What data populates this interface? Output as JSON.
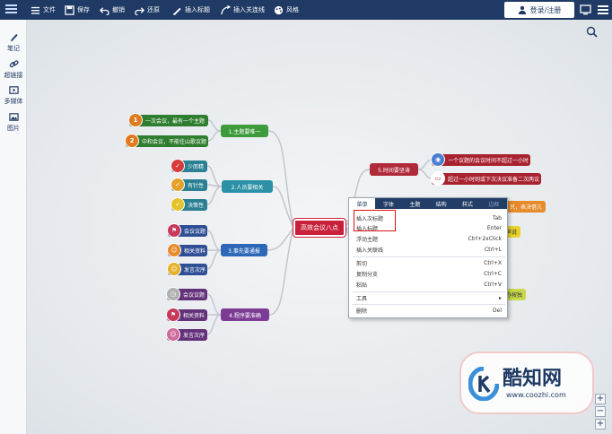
{
  "toolbar": {
    "file": "文件",
    "save": "保存",
    "undo": "撤销",
    "redo": "还原",
    "insert_title": "插入标题",
    "insert_relation": "插入关连线",
    "style": "风格",
    "login": "登录/注册"
  },
  "sidebar": {
    "items": [
      {
        "label": "笔记",
        "icon": "pen-icon"
      },
      {
        "label": "超链接",
        "icon": "link-icon"
      },
      {
        "label": "多媒体",
        "icon": "media-icon"
      },
      {
        "label": "图片",
        "icon": "image-icon"
      }
    ]
  },
  "mindmap": {
    "central": "高效会议八点",
    "branches": [
      {
        "label": "1.主题要唯一",
        "color": "#3d9b3c",
        "leaves": [
          {
            "label": "一次会议，最有一个主题",
            "num": "1"
          },
          {
            "label": "中和会议，不能往山歌议题",
            "num": "2"
          }
        ]
      },
      {
        "label": "2.人员要相关",
        "color": "#2c90a6",
        "leaves": [
          {
            "label": "少而精"
          },
          {
            "label": "有针性"
          },
          {
            "label": "决策性"
          }
        ]
      },
      {
        "label": "3.事先要通报",
        "color": "#2d67b8",
        "leaves": [
          {
            "label": "会议议题"
          },
          {
            "label": "相关资料"
          },
          {
            "label": "发言次序"
          }
        ]
      },
      {
        "label": "4.程序要准确",
        "color": "#7c3b94",
        "leaves": [
          {
            "label": "会议议题"
          },
          {
            "label": "相关资料"
          },
          {
            "label": "发言次序"
          }
        ]
      },
      {
        "label": "5.时间要坚涛",
        "color": "#b02a3a",
        "leaves": [
          {
            "label": "一个议题的会议时间不超过一小时"
          },
          {
            "label": "超过一小时则或下次决议准备二次两议"
          }
        ]
      }
    ],
    "partial_labels": [
      "只，表决借亢",
      "声说",
      "办按独"
    ]
  },
  "context_menu": {
    "tabs": [
      "菜单",
      "字体",
      "主题",
      "结构",
      "样式",
      "边框"
    ],
    "items": [
      {
        "label": "插入次标题",
        "shortcut": "Tab"
      },
      {
        "label": "插入标题",
        "shortcut": "Enter"
      },
      {
        "label": "浮动主题",
        "shortcut": "Ctrl+2xClick"
      },
      {
        "label": "插入关联线",
        "shortcut": "Ctrl+L"
      },
      {
        "label": "剪切",
        "shortcut": "Ctrl+X"
      },
      {
        "label": "复制分支",
        "shortcut": "Ctrl+C"
      },
      {
        "label": "粘贴",
        "shortcut": "Ctrl+V"
      },
      {
        "label": "工具",
        "shortcut": "▸"
      },
      {
        "label": "删除",
        "shortcut": "Del"
      }
    ]
  },
  "zoom": {
    "plus": "+",
    "minus": "−"
  },
  "watermark": {
    "title": "酷知网",
    "url": "www.coozhi.com"
  },
  "colors": {
    "toolbar": "#1f3a64",
    "central": "#c8203a",
    "highlight": "#dd1111"
  }
}
